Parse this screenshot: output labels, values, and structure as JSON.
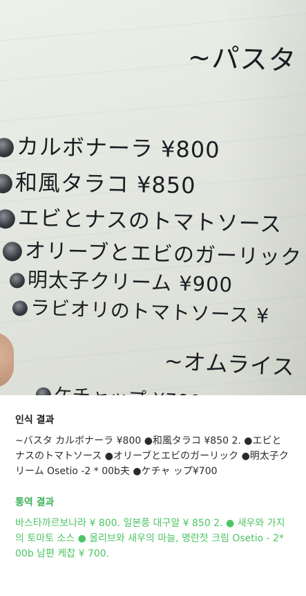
{
  "preview": {
    "menu_lines": [
      "~パスタ",
      "カルボナーラ ¥800",
      "和風タラコ ¥850",
      "エビとナスのトマトソース",
      "オリーブとエビのガーリック",
      "明太子クリーム ¥900",
      "ラビオリのトマトソース ¥",
      "~オムライス",
      "ケチャップ ¥700"
    ]
  },
  "recognition": {
    "title": "인식 결과",
    "text": "~バスタ カルボナーラ ¥800 ●和風タラコ ¥850 2. ●エビとナスのトマトソース ●オリーブとエビのガーリック ●明太子クリーム Osetio -2 * 00b夫 ●ケチャ ップ¥700"
  },
  "translation": {
    "title": "통역 결과",
    "text": "바스타까르보나라 ¥ 800. 일본풍 대구알 ¥ 850 2. ● 새우와 가지의 토마토 소스 ● 올리브와 새우의 마늘, 명란젓 크림 Osetio - 2* 00b 남편 케찹 ¥ 700."
  },
  "colors": {
    "translation_accent": "#4cc463",
    "title_text": "#1a1a1a",
    "body_text": "#2b2b2b"
  }
}
